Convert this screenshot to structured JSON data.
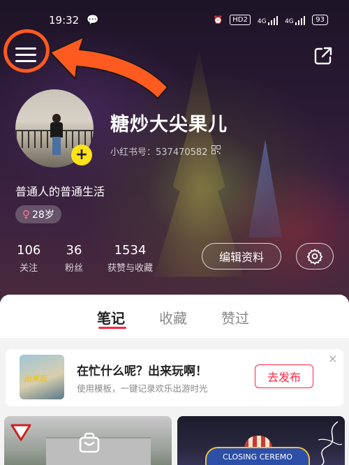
{
  "status_bar": {
    "time": "19:32",
    "wechat_icon": "wechat-icon",
    "hd_badge": "HD2",
    "signal1_label": "4G",
    "signal2_label": "4G",
    "battery": "93"
  },
  "profile": {
    "nickname": "糖炒大尖果儿",
    "redbook_id": "小红书号：537470582",
    "bio": "普通人的普通生活",
    "age_tag": "28岁",
    "gender_symbol": "♀",
    "stats": [
      {
        "value": "106",
        "label": "关注"
      },
      {
        "value": "36",
        "label": "粉丝"
      },
      {
        "value": "1534",
        "label": "获赞与收藏"
      }
    ],
    "edit_button": "编辑资料"
  },
  "tabs": [
    {
      "label": "笔记",
      "active": true
    },
    {
      "label": "收藏",
      "active": false
    },
    {
      "label": "赞过",
      "active": false
    }
  ],
  "promo": {
    "thumb_text": "出来玩",
    "title": "在忙什么呢？出来玩啊！",
    "subtitle": "使用模板，一键记录欢乐出游时光",
    "button": "去发布",
    "close": "×"
  },
  "cards": {
    "right_banner": "CLOSING CEREMO"
  },
  "colors": {
    "accent": "#ff2442",
    "annotation": "#ff5a1f",
    "plus_badge": "#ffe21a"
  }
}
